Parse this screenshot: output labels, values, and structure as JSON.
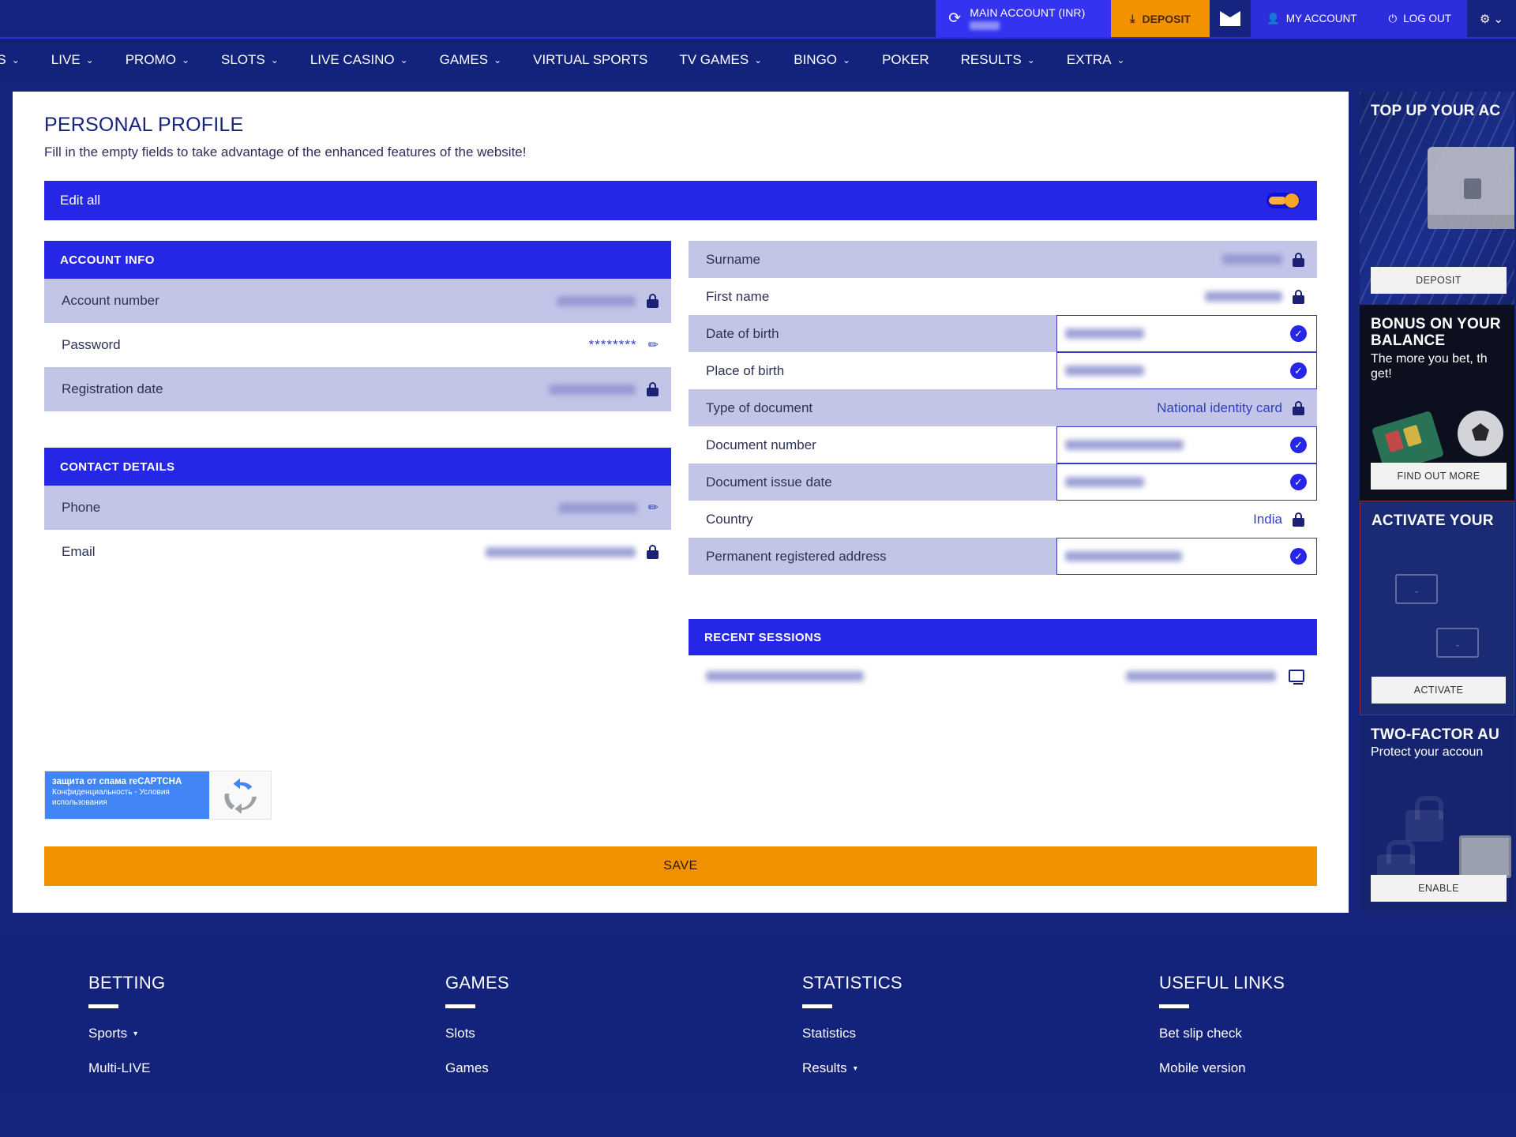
{
  "topbar": {
    "account_label": "MAIN ACCOUNT (INR)",
    "deposit_label": "DEPOSIT",
    "my_account_label": "MY ACCOUNT",
    "logout_label": "LOG OUT",
    "refresh_icon": "refresh-icon",
    "mail_icon": "mail-icon",
    "gear_icon": "gear-icon",
    "accent_orange": "#f39200",
    "accent_blue": "#3333f0"
  },
  "nav": {
    "items": [
      {
        "label": "TS",
        "caret": "⌄"
      },
      {
        "label": "LIVE",
        "caret": "⌄"
      },
      {
        "label": "PROMO",
        "caret": "⌄"
      },
      {
        "label": "SLOTS",
        "caret": "⌄"
      },
      {
        "label": "LIVE CASINO",
        "caret": "⌄"
      },
      {
        "label": "GAMES",
        "caret": "⌄"
      },
      {
        "label": "VIRTUAL SPORTS",
        "caret": ""
      },
      {
        "label": "TV GAMES",
        "caret": "⌄"
      },
      {
        "label": "BINGO",
        "caret": "⌄"
      },
      {
        "label": "POKER",
        "caret": ""
      },
      {
        "label": "RESULTS",
        "caret": "⌄"
      },
      {
        "label": "EXTRA",
        "caret": "⌄"
      }
    ]
  },
  "page": {
    "title": "PERSONAL PROFILE",
    "subtitle": "Fill in the empty fields to take advantage of the enhanced features of the website!",
    "edit_all_label": "Edit all",
    "save_label": "SAVE"
  },
  "account_info": {
    "header": "ACCOUNT INFO",
    "rows": [
      {
        "label": "Account number",
        "value": "",
        "masked": true,
        "icon": "lock-icon"
      },
      {
        "label": "Password",
        "value": "********",
        "masked": false,
        "icon": "pencil-icon"
      },
      {
        "label": "Registration date",
        "value": "",
        "masked": true,
        "icon": "lock-icon"
      }
    ]
  },
  "contact_details": {
    "header": "CONTACT DETAILS",
    "rows": [
      {
        "label": "Phone",
        "value": "",
        "masked": true,
        "icon": "pencil-icon"
      },
      {
        "label": "Email",
        "value": "",
        "masked": true,
        "icon": "lock-icon"
      }
    ]
  },
  "personal_fields": [
    {
      "label": "Surname",
      "value": "",
      "masked": true,
      "control": "locked",
      "icon": "lock-icon",
      "alt": true
    },
    {
      "label": "First name",
      "value": "",
      "masked": true,
      "control": "locked",
      "icon": "lock-icon",
      "alt": false
    },
    {
      "label": "Date of birth",
      "value": "",
      "masked": true,
      "control": "input",
      "icon": "check-icon",
      "alt": true
    },
    {
      "label": "Place of birth",
      "value": "",
      "masked": true,
      "control": "input",
      "icon": "check-icon",
      "alt": false
    },
    {
      "label": "Type of document",
      "value": "National identity card",
      "masked": false,
      "control": "locked",
      "icon": "lock-icon",
      "alt": true
    },
    {
      "label": "Document number",
      "value": "",
      "masked": true,
      "control": "input",
      "icon": "check-icon",
      "alt": false
    },
    {
      "label": "Document issue date",
      "value": "",
      "masked": true,
      "control": "input",
      "icon": "check-icon",
      "alt": true
    },
    {
      "label": "Country",
      "value": "India",
      "masked": false,
      "control": "locked",
      "icon": "lock-icon",
      "alt": false
    },
    {
      "label": "Permanent registered address",
      "value": "",
      "masked": true,
      "control": "input",
      "icon": "check-icon",
      "alt": true
    }
  ],
  "recent_sessions": {
    "header": "RECENT SESSIONS",
    "rows": [
      {
        "date": "",
        "device": "",
        "icon": "monitor-icon"
      }
    ]
  },
  "recaptcha": {
    "line1": "защита от спама reCAPTCHA",
    "line2": "Конфиденциальность - Условия использования",
    "icon": "recaptcha-icon"
  },
  "sidebar": {
    "promos": [
      {
        "title": "TOP UP YOUR AC",
        "subtitle": "",
        "button": "DEPOSIT"
      },
      {
        "title": "BONUS ON YOUR BALANCE",
        "subtitle": "The more you bet, th get!",
        "button": "FIND OUT MORE"
      },
      {
        "title": "ACTIVATE YOUR",
        "subtitle": "",
        "button": "ACTIVATE"
      },
      {
        "title": "TWO-FACTOR AU",
        "subtitle": "Protect your accoun",
        "button": "ENABLE"
      }
    ]
  },
  "footer": {
    "columns": [
      {
        "title": "BETTING",
        "links": [
          {
            "label": "Sports",
            "caret": "▾"
          },
          {
            "label": "Multi-LIVE",
            "caret": ""
          }
        ]
      },
      {
        "title": "GAMES",
        "links": [
          {
            "label": "Slots",
            "caret": ""
          },
          {
            "label": "Games",
            "caret": ""
          }
        ]
      },
      {
        "title": "STATISTICS",
        "links": [
          {
            "label": "Statistics",
            "caret": ""
          },
          {
            "label": "Results",
            "caret": "▾"
          }
        ]
      },
      {
        "title": "USEFUL LINKS",
        "links": [
          {
            "label": "Bet slip check",
            "caret": ""
          },
          {
            "label": "Mobile version",
            "caret": ""
          }
        ]
      }
    ]
  }
}
